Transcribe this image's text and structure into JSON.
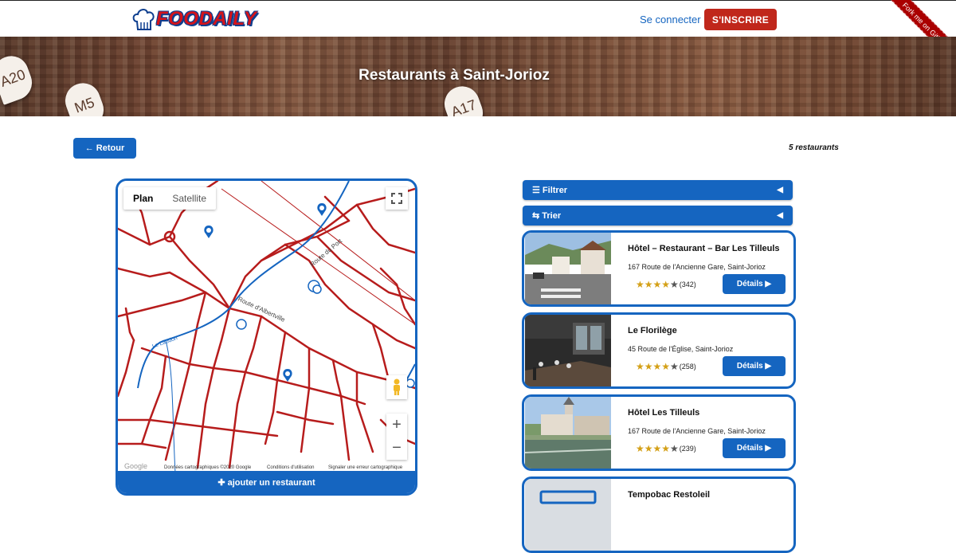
{
  "header": {
    "logo_text": "FOODAILY",
    "login_label": "Se connecter",
    "signup_label": "S'INSCRIRE",
    "ribbon_label": "Fork me on GitHub"
  },
  "hero": {
    "title": "Restaurants à Saint-Jorioz",
    "tags": [
      "A20",
      "M5",
      "A17"
    ]
  },
  "toolbar": {
    "back_label": "← Retour",
    "count_label": "5 restaurants"
  },
  "map": {
    "tab_plan": "Plan",
    "tab_satellite": "Satellite",
    "road_label_1": "Route du Port",
    "road_label_2": "Route d'Albertville",
    "road_label_3": "Le Laudon",
    "google_label": "Google",
    "footer_data": "Données cartographiques ©2020 Google",
    "footer_terms": "Conditions d'utilisation",
    "footer_report": "Signaler une erreur cartographique",
    "zoom_in": "+",
    "zoom_out": "−",
    "add_label": "✚ ajouter un restaurant"
  },
  "filters": {
    "filter_label": "☰ Filtrer",
    "sort_label": "⇆ Trier",
    "caret": "◀"
  },
  "restaurants": [
    {
      "name": "Hôtel – Restaurant – Bar Les Tilleuls",
      "address": "167 Route de l'Ancienne Gare, Saint-Jorioz",
      "rating": 4.5,
      "stars": "★★★★",
      "half": "★",
      "count": "(342)",
      "details": "Détails ▶"
    },
    {
      "name": "Le Florilège",
      "address": "45 Route de l'Église, Saint-Jorioz",
      "rating": 4.5,
      "stars": "★★★★",
      "half": "★",
      "count": "(258)",
      "details": "Détails ▶"
    },
    {
      "name": "Hôtel Les Tilleuls",
      "address": "167 Route de l'Ancienne Gare, Saint-Jorioz",
      "rating": 4.5,
      "stars": "★★★★",
      "half": "★",
      "count": "(239)",
      "details": "Détails ▶"
    },
    {
      "name": "Tempobac Restoleil"
    }
  ],
  "colors": {
    "primary": "#1565c0",
    "signup": "#c0271b",
    "roads": "#b71c1c",
    "star": "#d4a017"
  }
}
